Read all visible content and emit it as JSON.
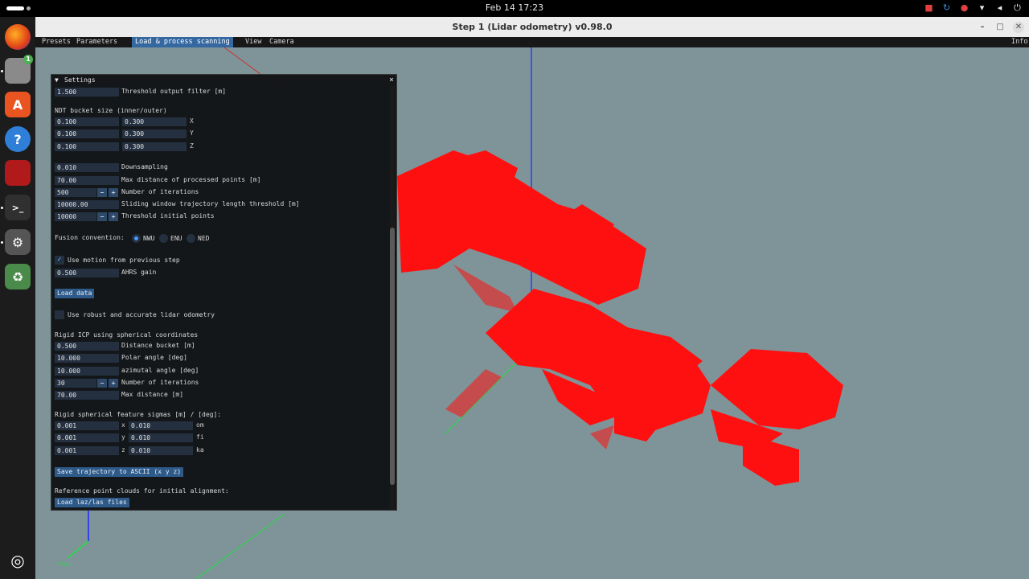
{
  "system": {
    "clock": "Feb 14  17:23"
  },
  "window": {
    "title": "Step 1 (Lidar odometry) v0.98.0"
  },
  "menubar": {
    "items": [
      "Presets",
      "Parameters",
      "Load & process scanning",
      "View",
      "Camera"
    ],
    "active": "Load & process scanning",
    "info": "Info"
  },
  "viewport": {
    "corner_axis_label": "Y(m)"
  },
  "settings": {
    "title": "Settings",
    "threshold_output_filter": {
      "value": "1.500",
      "label": "Threshold output filter [m]"
    },
    "ndt_bucket_label": "NDT bucket size (inner/outer)",
    "ndt_rows": [
      {
        "inner": "0.100",
        "outer": "0.300",
        "axis": "X"
      },
      {
        "inner": "0.100",
        "outer": "0.300",
        "axis": "Y"
      },
      {
        "inner": "0.100",
        "outer": "0.300",
        "axis": "Z"
      }
    ],
    "downsampling": {
      "value": "0.010",
      "label": "Downsampling"
    },
    "max_distance_processed": {
      "value": "70.00",
      "label": "Max distance of processed points [m]"
    },
    "number_of_iterations": {
      "value": "500",
      "label": "Number of iterations"
    },
    "sliding_window": {
      "value": "10000.00",
      "label": "Sliding window trajectory length threshold [m]"
    },
    "threshold_initial_points": {
      "value": "10000",
      "label": "Threshold initial points"
    },
    "fusion_convention_label": "Fusion convention:",
    "fusion_options": [
      "NWU",
      "ENU",
      "NED"
    ],
    "fusion_selected": "NWU",
    "use_motion_label": "Use motion from previous step",
    "use_motion_checked": true,
    "ahrs_gain": {
      "value": "0.500",
      "label": "AHRS gain"
    },
    "load_data_button": "Load data",
    "robust_label": "Use robust and accurate lidar odometry",
    "robust_checked": false,
    "rigid_icp_label": "Rigid ICP using spherical coordinates",
    "distance_bucket": {
      "value": "0.500",
      "label": "Distance bucket [m]"
    },
    "polar_angle": {
      "value": "10.000",
      "label": "Polar angle [deg]"
    },
    "azimutal_angle": {
      "value": "10.000",
      "label": "azimutal angle [deg]"
    },
    "icp_iterations": {
      "value": "30",
      "label": "Number of iterations"
    },
    "max_distance": {
      "value": "70.00",
      "label": "Max distance [m]"
    },
    "sigmas_label": "Rigid spherical feature sigmas [m] / [deg]:",
    "sigma_rows": [
      {
        "m_value": "0.001",
        "m_axis": "x",
        "deg_value": "0.010",
        "deg_axis": "om"
      },
      {
        "m_value": "0.001",
        "m_axis": "y",
        "deg_value": "0.010",
        "deg_axis": "fi"
      },
      {
        "m_value": "0.001",
        "m_axis": "z",
        "deg_value": "0.010",
        "deg_axis": "ka"
      }
    ],
    "save_trajectory_button": "Save trajectory to ASCII (x y z)",
    "reference_label": "Reference point clouds for initial alignment:",
    "load_laz_button": "Load laz/las files"
  },
  "colors": {
    "viewport_bg": "#7e9498",
    "point_cloud": "#ff1010",
    "axis_blue": "#1a2cff",
    "axis_green": "#20e040",
    "accent": "#3568a0"
  }
}
